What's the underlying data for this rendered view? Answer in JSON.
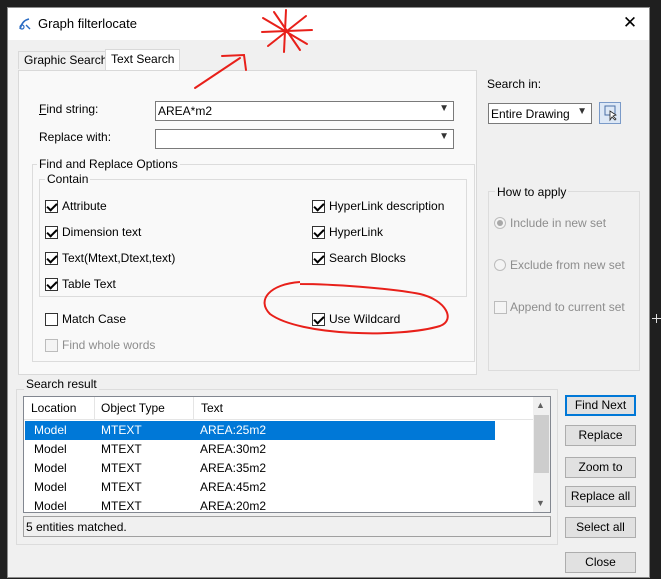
{
  "window": {
    "title": "Graph filterlocate"
  },
  "tabs": [
    {
      "label": "Graphic Search"
    },
    {
      "label": "Text Search"
    }
  ],
  "find_string": {
    "label": "Find string:",
    "value": "AREA*m2"
  },
  "replace_with": {
    "label": "Replace with:",
    "value": ""
  },
  "options": {
    "group_title": "Find and Replace Options",
    "contain_title": "Contain",
    "attribute": {
      "label": "Attribute",
      "checked": true
    },
    "dimension_text": {
      "label": "Dimension text",
      "checked": true
    },
    "text_types": {
      "label": "Text(Mtext,Dtext,text)",
      "checked": true
    },
    "table_text": {
      "label": "Table Text",
      "checked": true
    },
    "hyperlink_description": {
      "label": "HyperLink description",
      "checked": true
    },
    "hyperlink": {
      "label": "HyperLink",
      "checked": true
    },
    "search_blocks": {
      "label": "Search Blocks",
      "checked": true
    },
    "match_case": {
      "label": "Match Case",
      "checked": false
    },
    "use_wildcard": {
      "label": "Use Wildcard",
      "checked": true
    },
    "find_whole_words": {
      "label": "Find whole words",
      "checked": false
    }
  },
  "search_in": {
    "label": "Search in:",
    "value": "Entire Drawing"
  },
  "how_to_apply": {
    "title": "How to apply",
    "include_new_set": "Include in new set",
    "exclude_new_set": "Exclude from new set",
    "append_current_set": "Append to current set"
  },
  "search_result": {
    "title": "Search result",
    "columns": [
      "Location",
      "Object Type",
      "Text"
    ],
    "rows": [
      {
        "location": "Model",
        "type": "MTEXT",
        "text": "AREA:25m2",
        "selected": true
      },
      {
        "location": "Model",
        "type": "MTEXT",
        "text": "AREA:30m2",
        "selected": false
      },
      {
        "location": "Model",
        "type": "MTEXT",
        "text": "AREA:35m2",
        "selected": false
      },
      {
        "location": "Model",
        "type": "MTEXT",
        "text": "AREA:45m2",
        "selected": false
      },
      {
        "location": "Model",
        "type": "MTEXT",
        "text": "AREA:20m2",
        "selected": false
      }
    ],
    "status": "5 entities matched."
  },
  "buttons": {
    "find_next": "Find Next",
    "replace": "Replace",
    "zoom_to": "Zoom to",
    "replace_all": "Replace all",
    "select_all": "Select all",
    "close": "Close"
  },
  "colors": {
    "selection": "#0078d7",
    "annotation": "#e8201a",
    "dialog_bg": "#f0f0f0"
  }
}
